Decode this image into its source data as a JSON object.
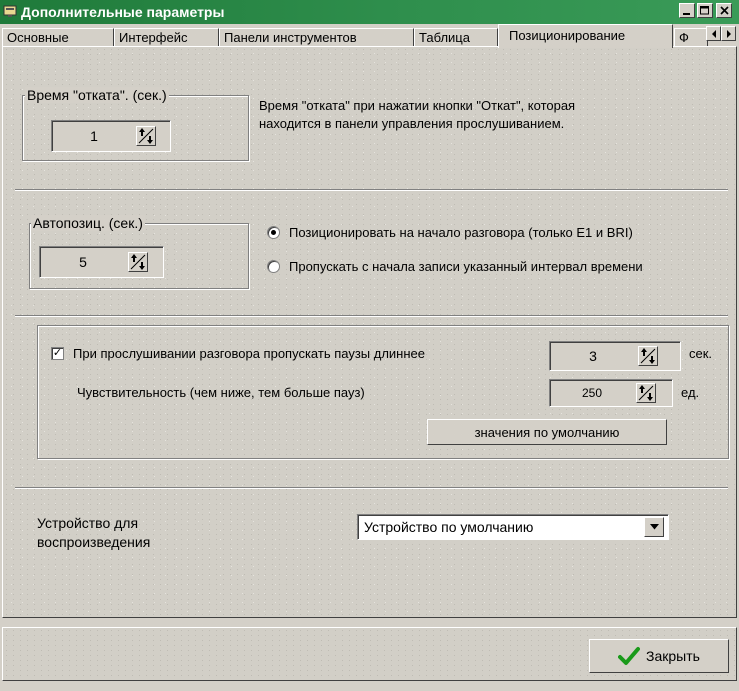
{
  "window": {
    "title": "Дополнительные параметры"
  },
  "tabs": [
    {
      "label": "Основные"
    },
    {
      "label": "Интерфейс"
    },
    {
      "label": "Панели инструментов"
    },
    {
      "label": "Таблица"
    },
    {
      "label": "Позиционирование"
    },
    {
      "label": "Ф"
    }
  ],
  "rollback": {
    "legend": "Время \"отката\". (сек.)",
    "value": "1",
    "description_line1": "Время \"отката\" при нажатии кнопки \"Откат\", которая",
    "description_line2": "находится  в панели управления прослушиванием."
  },
  "autopos": {
    "legend": "Автопозиц. (сек.)",
    "value": "5",
    "option1": "Позиционировать на начало разговора (только E1 и BRI)",
    "option2": "Пропускать с начала записи указанный интервал времени"
  },
  "pauses": {
    "skip_label": "При прослушивании разговора пропускать паузы длиннее",
    "skip_value": "3",
    "skip_unit": "сек.",
    "sens_label": "Чувствительность (чем ниже, тем больше пауз)",
    "sens_value": "250",
    "sens_unit": "ед.",
    "defaults_button": "значения по умолчанию"
  },
  "device": {
    "label_line1": "Устройство для",
    "label_line2": "воспроизведения",
    "selected": "Устройство по умолчанию"
  },
  "footer": {
    "close_button": "Закрыть"
  },
  "colors": {
    "title_bar": "#1f7a3a",
    "check_green": "#1a9a1a"
  }
}
